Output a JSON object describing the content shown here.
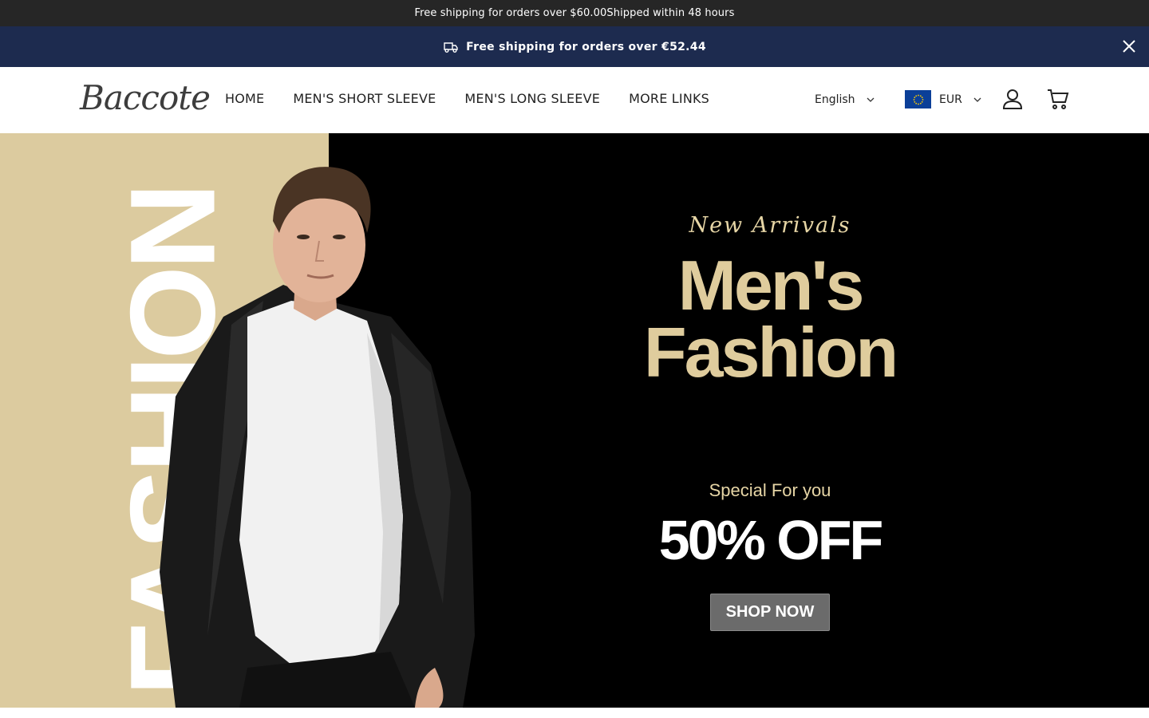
{
  "announcement": {
    "text": "Free shipping for orders over $60.00Shipped within 48 hours"
  },
  "shipping_bar": {
    "text": "Free shipping for orders over €52.44",
    "icon": "truck-icon",
    "close_icon": "close-icon"
  },
  "header": {
    "logo": "Baccote",
    "nav": [
      {
        "label": "HOME"
      },
      {
        "label": "MEN'S SHORT SLEEVE"
      },
      {
        "label": "MEN'S LONG SLEEVE"
      },
      {
        "label": "MORE LINKS"
      }
    ],
    "language": "English",
    "currency": "EUR",
    "icons": [
      "user-icon",
      "cart-icon",
      "eu-flag-icon",
      "chevron-down-icon"
    ]
  },
  "hero": {
    "side_word": "FASHION",
    "tagline": "New Arrivals",
    "title_line1": "Men's",
    "title_line2": "Fashion",
    "special": "Special For you",
    "discount": "50% OFF",
    "cta": "SHOP NOW"
  },
  "colors": {
    "topbar": "#262626",
    "shipbar": "#1d2b4f",
    "hero_bg": "#000000",
    "beige": "#dccb9f",
    "gold_text": "#dfcc9d",
    "button": "#6b6b6b"
  }
}
